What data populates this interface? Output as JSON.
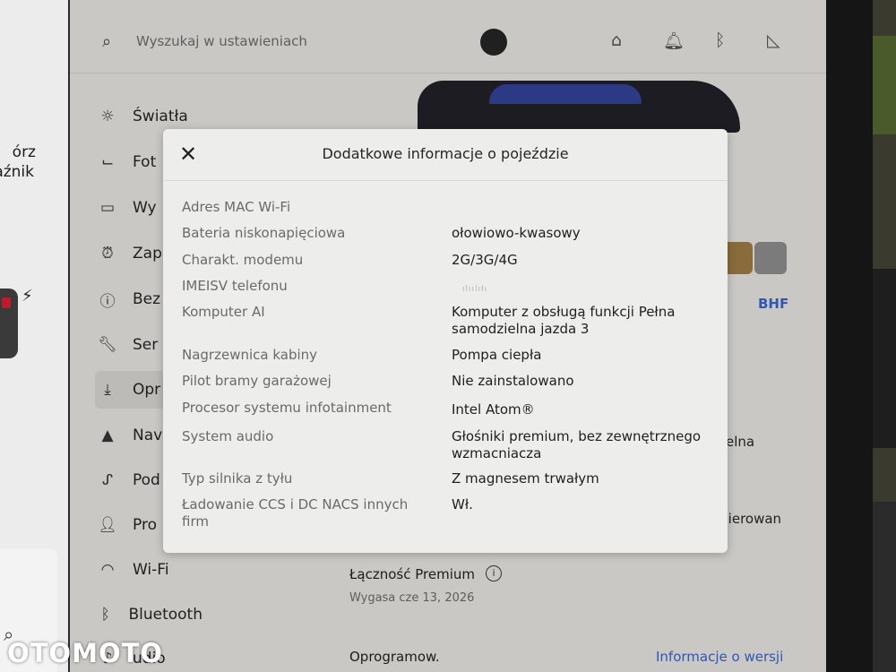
{
  "left_panel": {
    "line1": "órz",
    "line2": "aźnik"
  },
  "topbar": {
    "search_placeholder": "Wyszukaj w ustawieniach",
    "icons": [
      "search-icon",
      "garage-icon",
      "bell-icon",
      "bluetooth-icon",
      "signal-icon"
    ]
  },
  "sidebar": {
    "items": [
      {
        "label": "Światła",
        "icon": "sun-icon"
      },
      {
        "label": "Fot",
        "icon": "seat-icon"
      },
      {
        "label": "Wy",
        "icon": "display-icon"
      },
      {
        "label": "Zap",
        "icon": "alarm-icon"
      },
      {
        "label": "Bez",
        "icon": "alert-icon"
      },
      {
        "label": "Ser",
        "icon": "wrench-icon"
      },
      {
        "label": "Opr",
        "icon": "download-icon"
      },
      {
        "label": "Nav",
        "icon": "navigation-icon"
      },
      {
        "label": "Pod",
        "icon": "trip-icon"
      },
      {
        "label": "Pro",
        "icon": "profile-icon"
      },
      {
        "label": "Wi-Fi",
        "icon": "wifi-icon"
      },
      {
        "label": "Bluetooth",
        "icon": "bluetooth-icon"
      },
      {
        "label": "udio",
        "icon": "audio-icon"
      }
    ]
  },
  "background_right": {
    "bhf": "BHF",
    "frag1": "elna",
    "frag2": "kierowan"
  },
  "premium": {
    "title": "Łączność Premium",
    "subtitle": "Wygasa cze 13, 2026"
  },
  "software": {
    "label": "Oprogramow.",
    "link": "Informacje o wersji"
  },
  "modal": {
    "title": "Dodatkowe informacje o pojeździe",
    "rows": [
      {
        "label": "Adres MAC Wi-Fi",
        "value": ""
      },
      {
        "label": "Bateria niskonapięciowa",
        "value": "ołowiowo-kwasowy"
      },
      {
        "label": "Charakt. modemu",
        "value": "2G/3G/4G"
      },
      {
        "label": "IMEISV telefonu",
        "value": "ılıılıłı"
      },
      {
        "label": "Komputer AI",
        "value": "Komputer z obsługą funkcji Pełna samodzielna jazda 3"
      },
      {
        "label": "Nagrzewnica kabiny",
        "value": "Pompa ciepła"
      },
      {
        "label": "Pilot bramy garażowej",
        "value": "Nie zainstalowano"
      },
      {
        "label": "Procesor systemu infotainment",
        "value": "Intel Atom®"
      },
      {
        "label": "System audio",
        "value": "Głośniki premium, bez zewnętrznego wzmacniacza"
      },
      {
        "label": "Typ silnika z tyłu",
        "value": "Z magnesem trwałym"
      },
      {
        "label": "Ładowanie CCS i DC NACS innych firm",
        "value": "Wł."
      }
    ]
  },
  "watermark": "OTOMOTO"
}
